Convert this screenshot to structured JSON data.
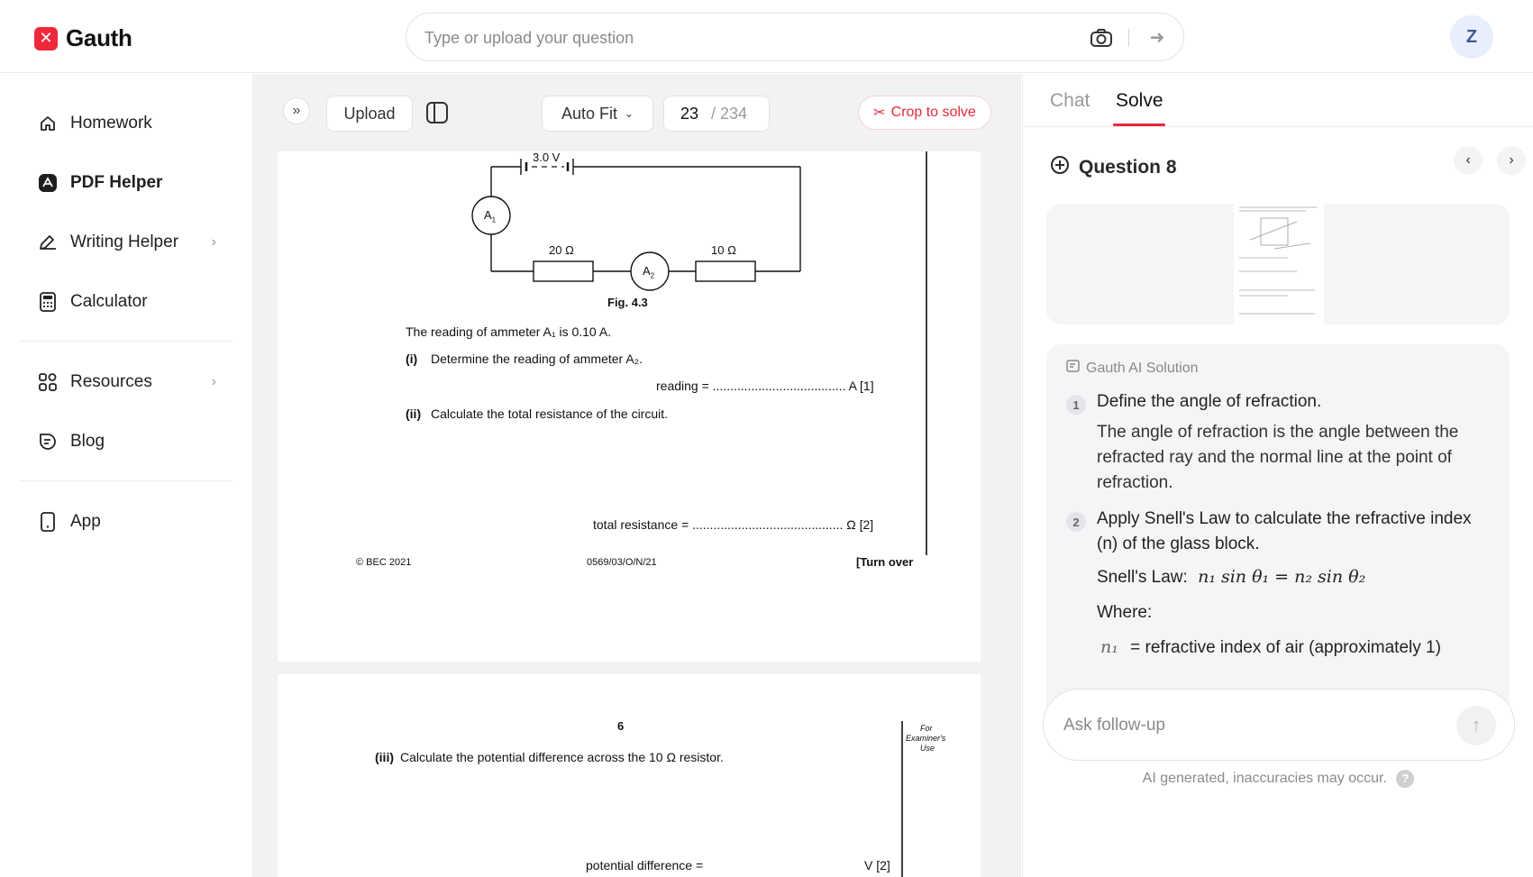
{
  "header": {
    "logo_text": "Gauth",
    "search_placeholder": "Type or upload your question",
    "avatar_initial": "Z"
  },
  "sidebar": {
    "items": [
      {
        "label": "Homework",
        "icon": "home-icon"
      },
      {
        "label": "PDF Helper",
        "icon": "pdf-icon",
        "active": true
      },
      {
        "label": "Writing Helper",
        "icon": "pen-icon"
      },
      {
        "label": "Calculator",
        "icon": "calculator-icon"
      },
      {
        "label": "Resources",
        "icon": "grid-icon"
      },
      {
        "label": "Blog",
        "icon": "blog-icon"
      },
      {
        "label": "App",
        "icon": "phone-icon"
      }
    ]
  },
  "toolbar": {
    "upload_label": "Upload",
    "fit_label": "Auto Fit",
    "page_current": "23",
    "page_total": "/ 234",
    "crop_label": "Crop to solve"
  },
  "pdf": {
    "page1": {
      "voltage_label": "3.0 V",
      "a1_label": "A",
      "a1_sub": "1",
      "a2_label": "A",
      "a2_sub": "2",
      "r1_label": "20 Ω",
      "r2_label": "10 Ω",
      "fig_label": "Fig. 4.3",
      "reading_stmt": "The reading of ammeter A₁ is 0.10 A.",
      "q_i_num": "(i)",
      "q_i_text": "Determine the reading of ammeter A₂.",
      "reading_line": "reading = ...................................... A [1]",
      "q_ii_num": "(ii)",
      "q_ii_text": "Calculate the total resistance of the circuit.",
      "resistance_line": "total resistance = ........................................... Ω [2]",
      "copyright": "© BEC 2021",
      "code": "0569/03/O/N/21",
      "turn_over": "[Turn over"
    },
    "page2": {
      "page_number": "6",
      "examiner_1": "For",
      "examiner_2": "Examiner's",
      "examiner_3": "Use",
      "q_iii_num": "(iii)",
      "q_iii_text": "Calculate the potential difference across the 10 Ω resistor.",
      "pd_line": "potential difference =",
      "pd_mark": "V [2]"
    }
  },
  "right_panel": {
    "tabs": [
      {
        "label": "Chat",
        "active": false
      },
      {
        "label": "Solve",
        "active": true
      }
    ],
    "question_title": "Question 8",
    "solution_header": "Gauth AI Solution",
    "steps": [
      {
        "num": "1",
        "title": "Define the angle of refraction.",
        "body": "The angle of refraction is the angle between the refracted ray and the normal line at the point of refraction."
      },
      {
        "num": "2",
        "title": "Apply Snell's Law to calculate the refractive index (n) of the glass block.",
        "law_prefix": "Snell's Law:",
        "law_formula": "n₁ sin θ₁ = n₂ sin θ₂",
        "where": "Where:",
        "n1_sym": "n₁",
        "n1_def": "= refractive index of air (approximately 1)"
      }
    ],
    "ask_placeholder": "Ask follow-up",
    "disclaimer": "AI generated, inaccuracies may occur.",
    "help_symbol": "?"
  },
  "colors": {
    "brand": "#f0283c",
    "active_tab_underline": "#e8283a"
  }
}
